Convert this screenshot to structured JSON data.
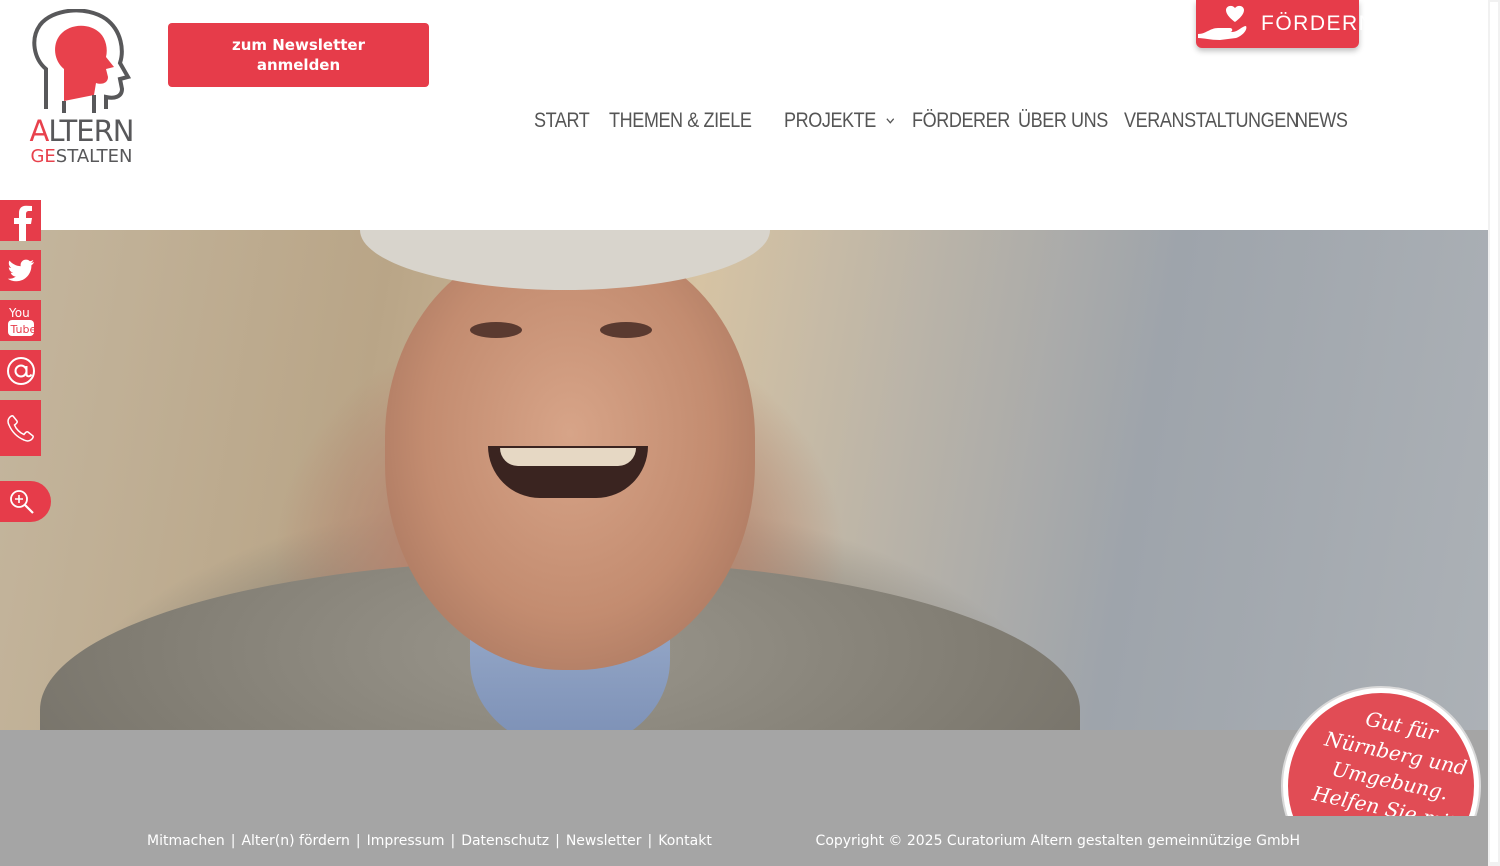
{
  "logo": {
    "line1_first": "A",
    "line1_rest": "LTERN",
    "line2_first": "GE",
    "line2_rest": "STALTEN",
    "colors": {
      "red": "#e8414c",
      "grey": "#58585a"
    }
  },
  "header": {
    "newsletter_button": "zum Newsletter anmelden",
    "foerdern_tab": "FÖRDERN",
    "foerdern_icon": "hand-heart-icon"
  },
  "nav": {
    "items": [
      {
        "label": "START",
        "dropdown": false
      },
      {
        "label": "THEMEN & ZIELE",
        "dropdown": true
      },
      {
        "label": "PROJEKTE",
        "dropdown": true
      },
      {
        "label": "FÖRDERER",
        "dropdown": false
      },
      {
        "label": "ÜBER UNS",
        "dropdown": false
      },
      {
        "label": "VERANSTALTUNGEN",
        "dropdown": false
      },
      {
        "label": "NEWS",
        "dropdown": false
      }
    ]
  },
  "social": {
    "icons": [
      "facebook-icon",
      "twitter-icon",
      "youtube-icon",
      "email-icon",
      "phone-icon"
    ],
    "search_icon": "zoom-search-icon"
  },
  "stamp": {
    "text": "Gut für Nürnberg und Umgebung. Helfen Sie mit"
  },
  "footer": {
    "links": [
      "Mitmachen",
      "Alter(n) fördern",
      "Impressum",
      "Datenschutz",
      "Newsletter",
      "Kontakt"
    ],
    "separator": "|",
    "copyright": "Copyright © 2025 Curatorium Altern gestalten gemeinnützige GmbH"
  },
  "colors": {
    "accent": "#e63c4a",
    "nav_text": "#555555",
    "footer_bg": "#a5a5a5"
  }
}
